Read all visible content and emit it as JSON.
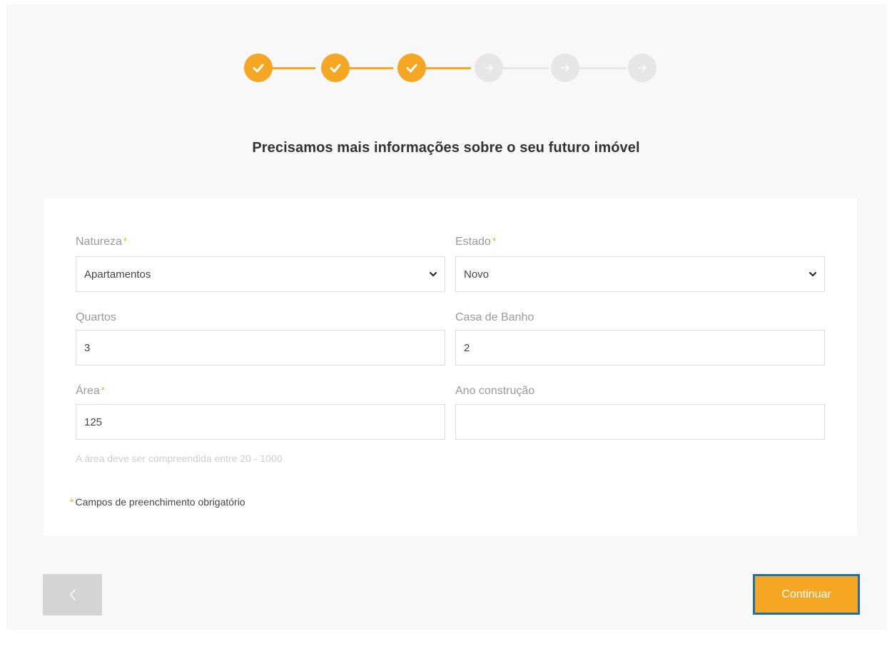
{
  "stepper": {
    "steps": [
      {
        "status": "completed",
        "icon": "check-icon"
      },
      {
        "status": "completed",
        "icon": "check-icon"
      },
      {
        "status": "completed",
        "icon": "check-icon"
      },
      {
        "status": "pending",
        "icon": "arrow-right-icon"
      },
      {
        "status": "pending",
        "icon": "arrow-right-icon"
      },
      {
        "status": "pending",
        "icon": "arrow-right-icon"
      }
    ],
    "completed_color": "#f5a623",
    "pending_color": "#e6e6e6"
  },
  "heading": "Precisamos mais informações sobre o seu futuro imóvel",
  "form": {
    "natureza": {
      "label": "Natureza",
      "required_mark": "*",
      "value": "Apartamentos",
      "options": [
        "Apartamentos"
      ]
    },
    "estado": {
      "label": "Estado",
      "required_mark": "*",
      "value": "Novo",
      "options": [
        "Novo"
      ]
    },
    "quartos": {
      "label": "Quartos",
      "value": "3"
    },
    "casa_de_banho": {
      "label": "Casa de Banho",
      "value": "2"
    },
    "area": {
      "label": "Área",
      "required_mark": "*",
      "value": "125",
      "hint": "A área deve ser compreendida entre 20 - 1000"
    },
    "ano_construcao": {
      "label": "Ano construção",
      "value": ""
    },
    "required_note": {
      "star": "*",
      "text": "Campos de preenchimento obrigatório"
    }
  },
  "buttons": {
    "back_icon": "chevron-left-icon",
    "continue_label": "Continuar"
  },
  "colors": {
    "accent": "#f5a623",
    "focus_border": "#1f6fa8",
    "back_button": "#d4d4d4"
  }
}
